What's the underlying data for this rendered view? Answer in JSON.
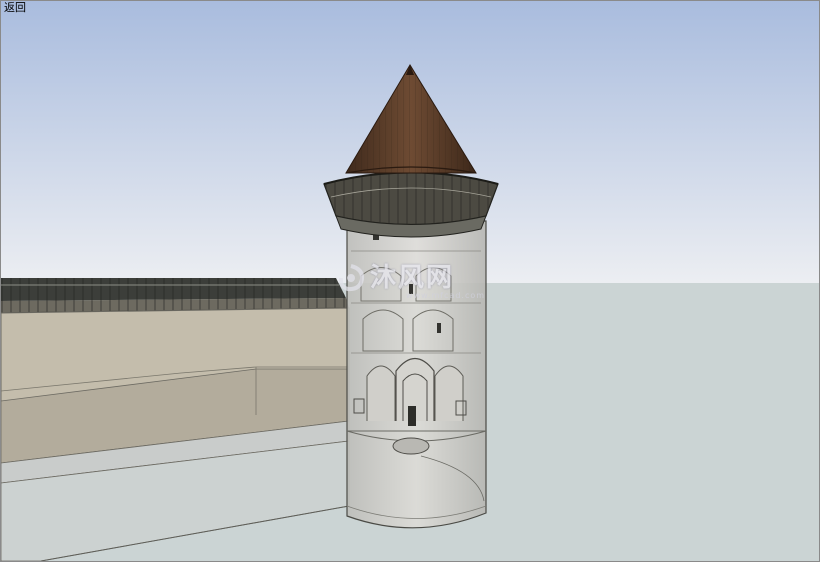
{
  "nav": {
    "back_label": "返回"
  },
  "watermark": {
    "text": "沐风网",
    "sub": "www.mfcad.com"
  },
  "colors": {
    "sky_top": "#a9bcde",
    "sky_bottom": "#e9ecf1",
    "ground": "#cbd4d4",
    "wall": "#c4bcab",
    "roof": "#6b4a33"
  }
}
